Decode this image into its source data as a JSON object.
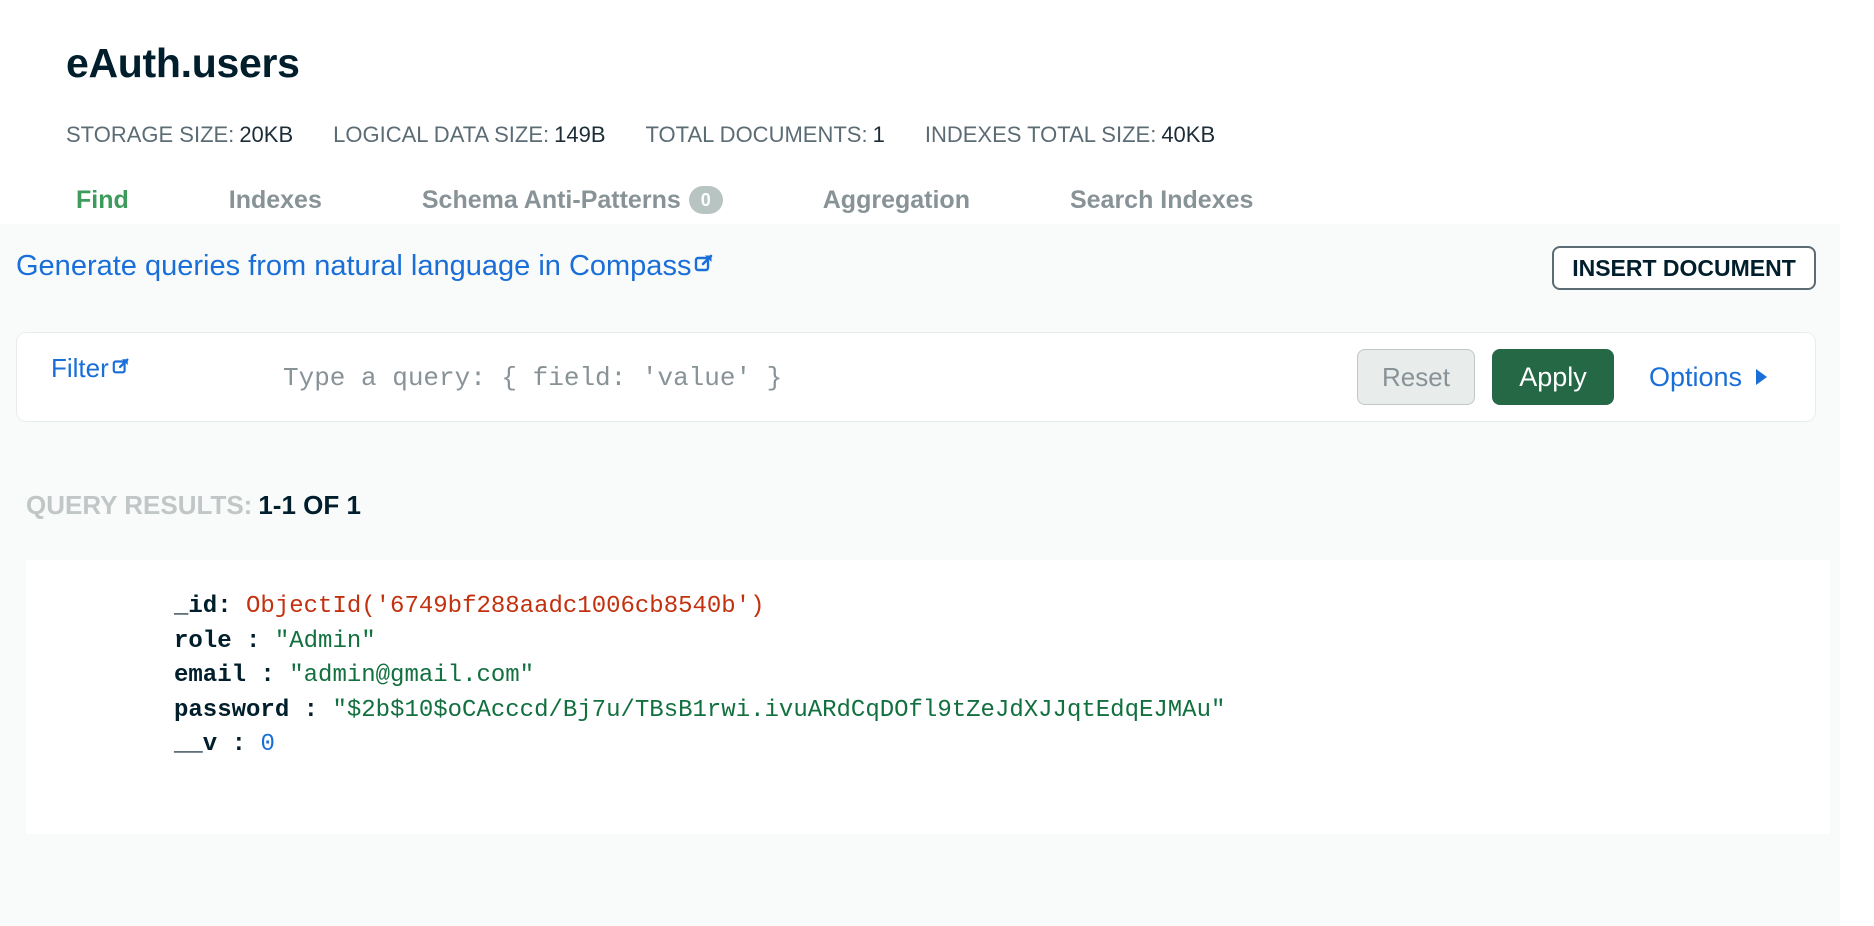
{
  "header": {
    "title": "eAuth.users",
    "stats": [
      {
        "label": "STORAGE SIZE:",
        "value": "20KB"
      },
      {
        "label": "LOGICAL DATA SIZE:",
        "value": "149B"
      },
      {
        "label": "TOTAL DOCUMENTS:",
        "value": "1"
      },
      {
        "label": "INDEXES TOTAL SIZE:",
        "value": "40KB"
      }
    ],
    "tabs": [
      {
        "label": "Find",
        "active": true
      },
      {
        "label": "Indexes"
      },
      {
        "label": "Schema Anti-Patterns",
        "badge": "0"
      },
      {
        "label": "Aggregation"
      },
      {
        "label": "Search Indexes"
      }
    ]
  },
  "main": {
    "nl_link": "Generate queries from natural language in Compass",
    "insert_button": "INSERT DOCUMENT",
    "filter": {
      "label": "Filter",
      "placeholder": "Type a query: { field: 'value' }",
      "value": "",
      "reset_label": "Reset",
      "apply_label": "Apply",
      "options_label": "Options"
    },
    "results": {
      "label": "QUERY RESULTS:",
      "value": "1-1 OF 1"
    },
    "document": {
      "fields": [
        {
          "key": "_id",
          "sep": ": ",
          "value": "ObjectId('6749bf288aadc1006cb8540b')",
          "type": "objectid"
        },
        {
          "key": "role",
          "sep": " : ",
          "value": "\"Admin\"",
          "type": "string"
        },
        {
          "key": "email",
          "sep": " : ",
          "value": "\"admin@gmail.com\"",
          "type": "string"
        },
        {
          "key": "password",
          "sep": " : ",
          "value": "\"$2b$10$oCAcccd/Bj7u/TBsB1rwi.ivuARdCqDOfl9tZeJdXJJqtEdqEJMAu\"",
          "type": "string"
        },
        {
          "key": "__v",
          "sep": " : ",
          "value": "0",
          "type": "number"
        }
      ]
    }
  },
  "colors": {
    "accent_green": "#3d9b5c",
    "apply_green": "#246846",
    "link_blue": "#1a6ed8",
    "objectid_red": "#c3310f",
    "string_green": "#12703f"
  },
  "icons": {
    "external_link": "external-link-icon",
    "options_caret": "caret-right-icon"
  }
}
